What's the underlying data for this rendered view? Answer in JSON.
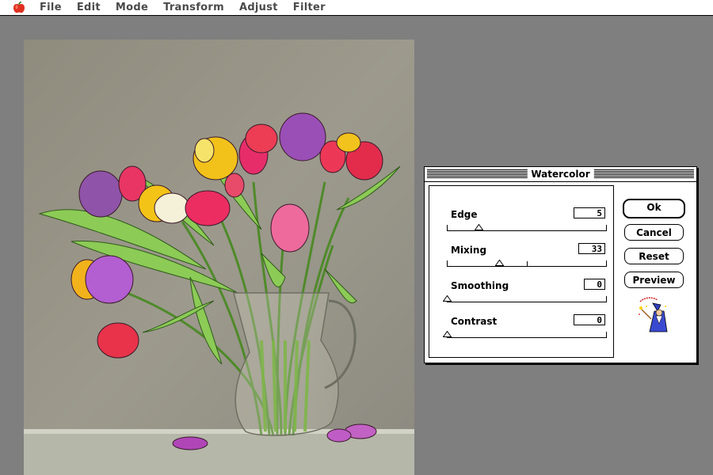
{
  "menubar": {
    "apple_icon": "apple-icon",
    "items": [
      "File",
      "Edit",
      "Mode",
      "Transform",
      "Adjust",
      "Filter"
    ]
  },
  "dialog": {
    "title": "Watercolor",
    "params": [
      {
        "label": "Edge",
        "value": "5",
        "slider_fraction": 0.2
      },
      {
        "label": "Mixing",
        "value": "33",
        "slider_fraction": 0.33
      },
      {
        "label": "Smoothing",
        "value": "0",
        "slider_fraction": 0.0
      },
      {
        "label": "Contrast",
        "value": "0",
        "slider_fraction": 0.0
      }
    ],
    "buttons": {
      "ok": "Ok",
      "cancel": "Cancel",
      "reset": "Reset",
      "preview": "Preview"
    },
    "wizard_icon": "wizard-icon"
  },
  "image": {
    "subject_icon": "tulip-watercolor-image"
  }
}
